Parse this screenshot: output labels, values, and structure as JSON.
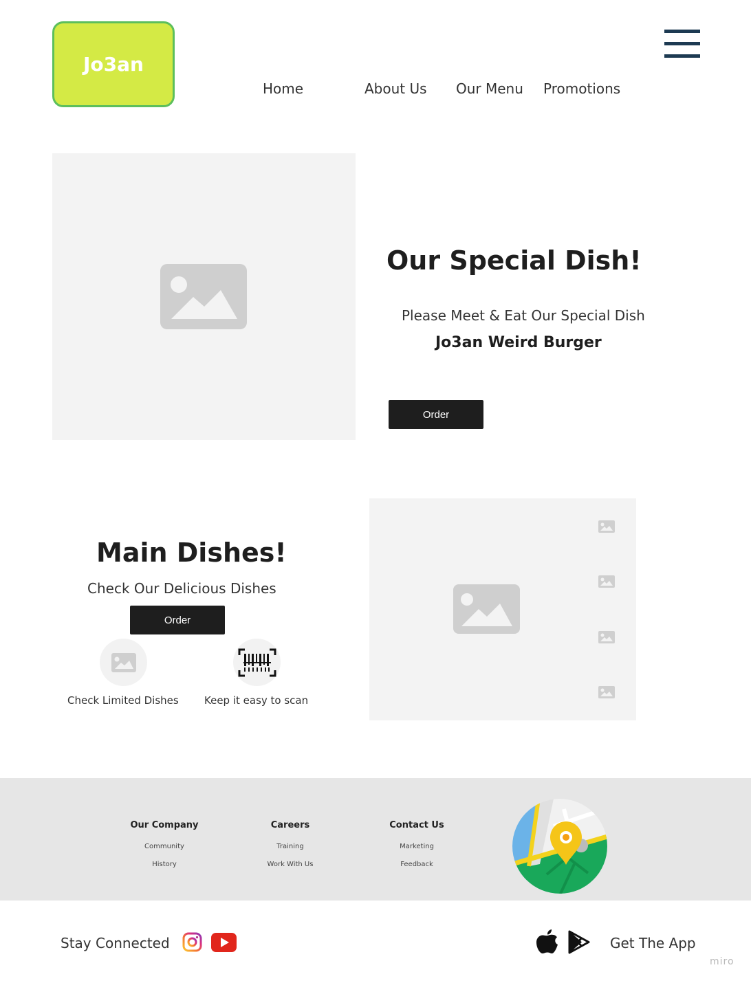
{
  "header": {
    "logo_text": "Jo3an",
    "nav": [
      "Home",
      "About Us",
      "Our Menu",
      "Promotions"
    ],
    "menu_icon": "hamburger-icon"
  },
  "special": {
    "title": "Our Special Dish!",
    "subtitle": "Please Meet & Eat Our Special Dish",
    "dish_name": "Jo3an Weird Burger",
    "order_label": "Order"
  },
  "main_dishes": {
    "title": "Main Dishes!",
    "subtitle": "Check Our Delicious Dishes",
    "order_label": "Order",
    "features": [
      {
        "label": "Check Limited Dishes",
        "icon": "image-icon"
      },
      {
        "label": "Keep it easy to scan",
        "icon": "barcode-icon"
      }
    ]
  },
  "footer": {
    "columns": [
      {
        "heading": "Our Company",
        "links": [
          "Community",
          "History"
        ]
      },
      {
        "heading": "Careers",
        "links": [
          "Training",
          "Work With Us"
        ]
      },
      {
        "heading": "Contact Us",
        "links": [
          "Marketing",
          "Feedback"
        ]
      }
    ],
    "map_icon": "map-pin-icon"
  },
  "bottom": {
    "stay_connected": "Stay Connected",
    "get_app": "Get The App",
    "social_icons": [
      "instagram-icon",
      "youtube-icon"
    ],
    "store_icons": [
      "apple-icon",
      "google-play-icon"
    ]
  },
  "watermark": "miro",
  "colors": {
    "logo_bg": "#d4ea45",
    "logo_border": "#5cbf5c",
    "button_bg": "#1e1e1e",
    "hamburger": "#1d3a52",
    "footer_bg": "#e6e6e6"
  }
}
